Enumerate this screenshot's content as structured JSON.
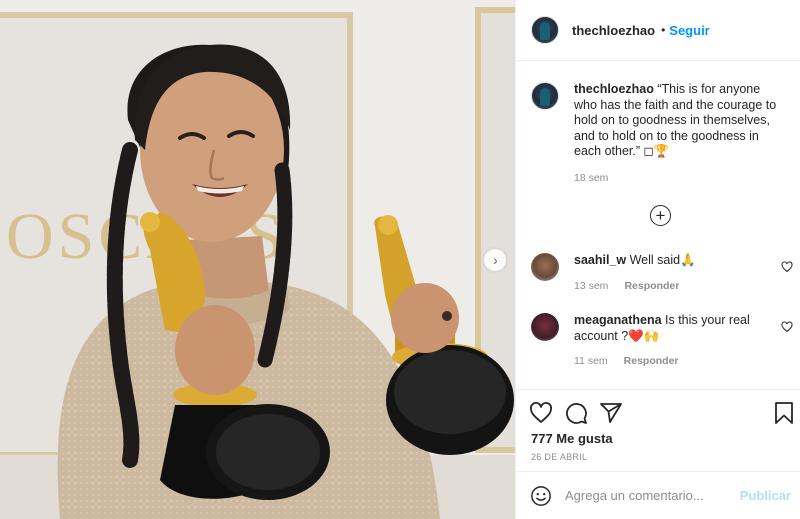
{
  "post": {
    "username": "thechloezhao",
    "separator": "•",
    "follow_label": "Seguir",
    "photo_wall_text": "OSCARS",
    "caption_text": "“This is for anyone who has the faith and the courage to hold on to goodness in themselves, and to hold on to the goodness in each other.” ◻🏆",
    "caption_time": "18 sem",
    "more_comments_symbol": "+",
    "carousel_next_symbol": "›"
  },
  "comments": [
    {
      "username": "saahil_w",
      "text": "Well said🙏",
      "time": "13 sem",
      "reply_label": "Responder"
    },
    {
      "username": "meaganathena",
      "text": "Is this your real account ?❤️🙌",
      "time": "11 sem",
      "reply_label": "Responder"
    }
  ],
  "actions": {
    "likes": "777 Me gusta",
    "date": "26 DE ABRIL",
    "icons": [
      "heart-icon",
      "comment-icon",
      "share-icon",
      "bookmark-icon"
    ]
  },
  "add_comment": {
    "placeholder": "Agrega un comentario...",
    "post_label": "Publicar"
  },
  "colors": {
    "link_blue": "#0095f6",
    "disabled_blue": "#b2dffc",
    "muted_text": "#8e8e8e",
    "border": "#efefef"
  }
}
